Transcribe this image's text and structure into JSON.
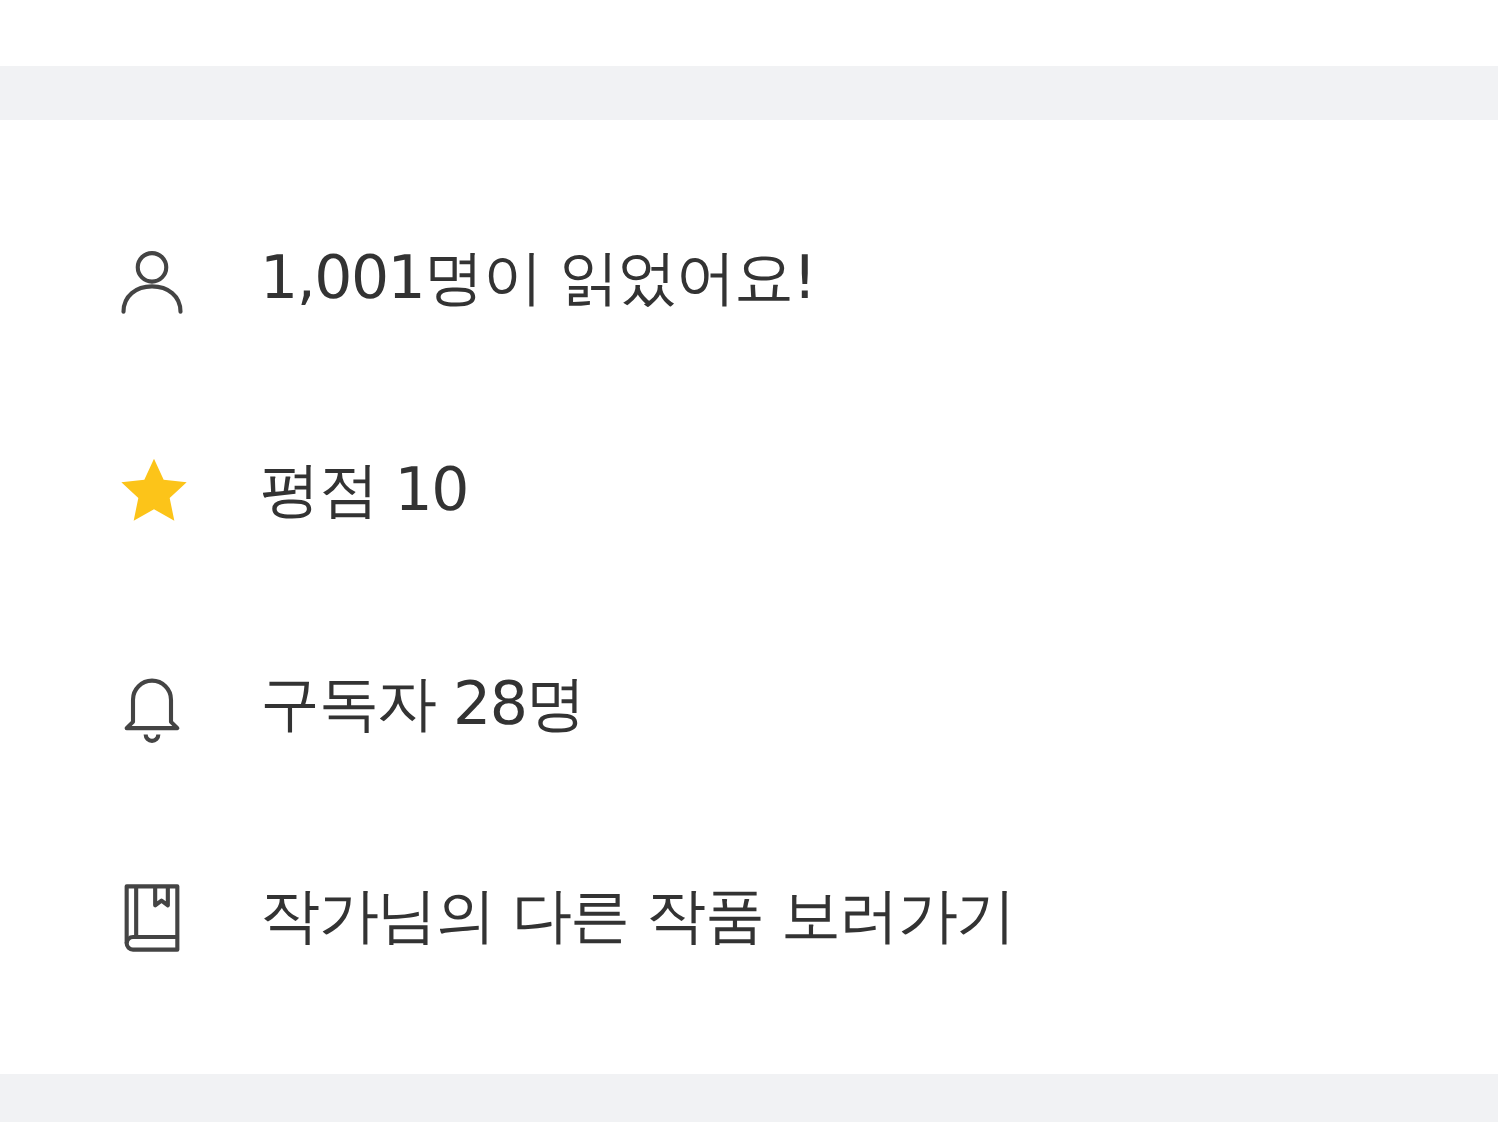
{
  "info_items": [
    {
      "label": "1,001명이 읽었어요!"
    },
    {
      "label": "평점 10"
    },
    {
      "label": "구독자 28명"
    },
    {
      "label": "작가님의 다른 작품 보러가기"
    }
  ]
}
